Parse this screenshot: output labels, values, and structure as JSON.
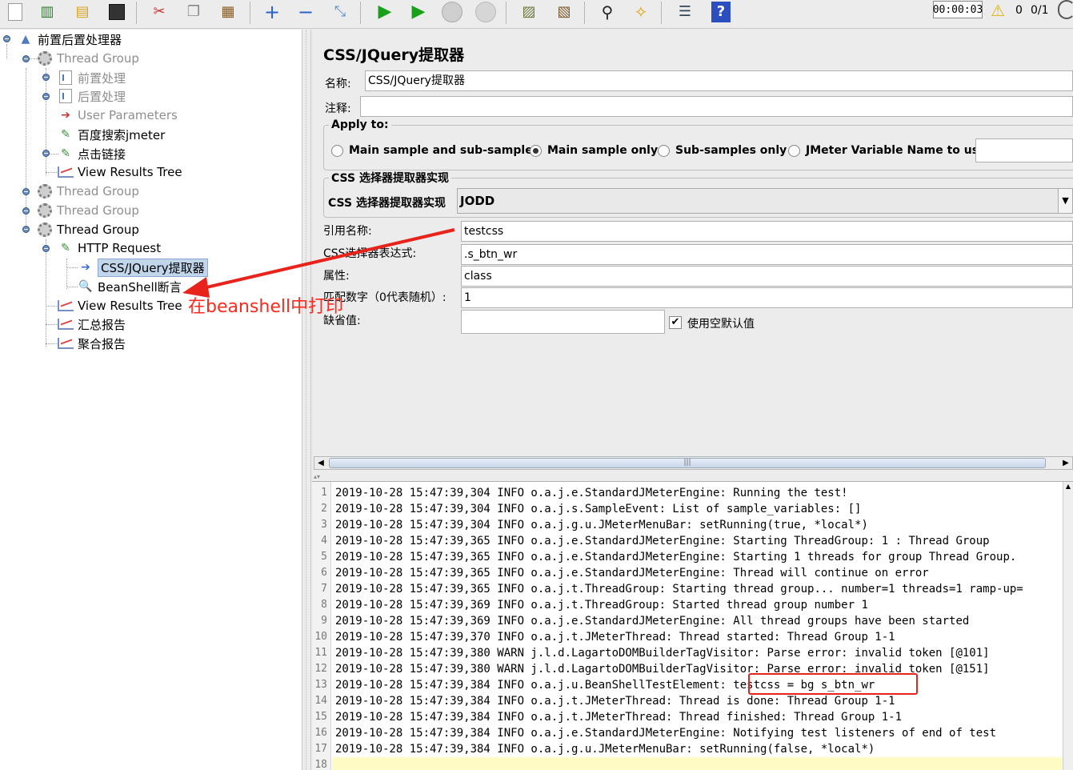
{
  "toolbar": {
    "buttons": [
      "new",
      "templates",
      "open",
      "save",
      "cut",
      "copy",
      "paste",
      "expand",
      "collapse",
      "toggle",
      "start",
      "start-no-pause",
      "stop",
      "shutdown",
      "clear",
      "clear-all",
      "search",
      "reset-search",
      "function-helper",
      "help"
    ],
    "timer": "00:00:03",
    "error_count": "0",
    "thread_count": "0/1"
  },
  "tree": {
    "root": "前置后置处理器",
    "tg1": "Thread Group",
    "pre": "前置处理",
    "post": "后置处理",
    "userparams": "User Parameters",
    "baidu": "百度搜索jmeter",
    "click": "点击链接",
    "vrt1": "View Results Tree",
    "tg2": "Thread Group",
    "tg3": "Thread Group",
    "tg4": "Thread Group",
    "http": "HTTP Request",
    "css": "CSS/JQuery提取器",
    "beanshell": "BeanShell断言",
    "vrt2": "View Results Tree",
    "summary": "汇总报告",
    "aggregate": "聚合报告"
  },
  "panel": {
    "title": "CSS/JQuery提取器",
    "name_label": "名称:",
    "name_value": "CSS/JQuery提取器",
    "comment_label": "注释:",
    "comment_value": "",
    "apply_to": "Apply to:",
    "radios": [
      "Main sample and sub-samples",
      "Main sample only",
      "Sub-samples only",
      "JMeter Variable Name to use"
    ],
    "selected_radio": "Main sample only",
    "impl_legend": "CSS 选择器提取器实现",
    "impl_label": "CSS 选择器提取器实现",
    "impl_value": "JODD",
    "ref_label": "引用名称:",
    "ref_value": "testcss",
    "expr_label": "CSS选择器表达式:",
    "expr_value": ".s_btn_wr",
    "attr_label": "属性:",
    "attr_value": "class",
    "match_label": "匹配数字（0代表随机）:",
    "match_value": "1",
    "default_label": "缺省值:",
    "default_value": "",
    "use_empty_label": "使用空默认值",
    "use_empty_checked": true
  },
  "log": {
    "lines": [
      "2019-10-28 15:47:39,304 INFO o.a.j.e.StandardJMeterEngine: Running the test!",
      "2019-10-28 15:47:39,304 INFO o.a.j.s.SampleEvent: List of sample_variables: []",
      "2019-10-28 15:47:39,304 INFO o.a.j.g.u.JMeterMenuBar: setRunning(true, *local*)",
      "2019-10-28 15:47:39,365 INFO o.a.j.e.StandardJMeterEngine: Starting ThreadGroup: 1 : Thread Group",
      "2019-10-28 15:47:39,365 INFO o.a.j.e.StandardJMeterEngine: Starting 1 threads for group Thread Group.",
      "2019-10-28 15:47:39,365 INFO o.a.j.e.StandardJMeterEngine: Thread will continue on error",
      "2019-10-28 15:47:39,365 INFO o.a.j.t.ThreadGroup: Starting thread group... number=1 threads=1 ramp-up=",
      "2019-10-28 15:47:39,369 INFO o.a.j.t.ThreadGroup: Started thread group number 1",
      "2019-10-28 15:47:39,369 INFO o.a.j.e.StandardJMeterEngine: All thread groups have been started",
      "2019-10-28 15:47:39,370 INFO o.a.j.t.JMeterThread: Thread started: Thread Group 1-1",
      "2019-10-28 15:47:39,380 WARN j.l.d.LagartoDOMBuilderTagVisitor: Parse error: invalid token [@101]",
      "2019-10-28 15:47:39,380 WARN j.l.d.LagartoDOMBuilderTagVisitor: Parse error: invalid token [@151]",
      "2019-10-28 15:47:39,384 INFO o.a.j.u.BeanShellTestElement: testcss = bg s_btn_wr",
      "2019-10-28 15:47:39,384 INFO o.a.j.t.JMeterThread: Thread is done: Thread Group 1-1",
      "2019-10-28 15:47:39,384 INFO o.a.j.t.JMeterThread: Thread finished: Thread Group 1-1",
      "2019-10-28 15:47:39,384 INFO o.a.j.e.StandardJMeterEngine: Notifying test listeners of end of test",
      "2019-10-28 15:47:39,384 INFO o.a.j.g.u.JMeterMenuBar: setRunning(false, *local*)",
      ""
    ],
    "line_numbers": [
      "1",
      "2",
      "3",
      "4",
      "5",
      "6",
      "7",
      "8",
      "9",
      "10",
      "11",
      "12",
      "13",
      "14",
      "15",
      "16",
      "17",
      "18"
    ]
  },
  "annotation": {
    "text": "在beanshell中打印",
    "color": "#e8231b"
  }
}
